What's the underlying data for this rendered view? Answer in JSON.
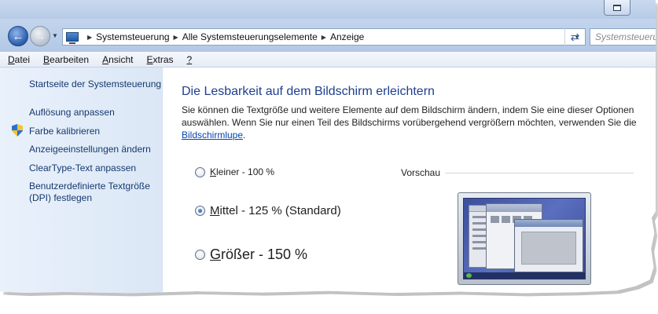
{
  "window": {
    "title_button": "restore-button"
  },
  "address_bar": {
    "breadcrumbs": [
      "Systemsteuerung",
      "Alle Systemsteuerungselemente",
      "Anzeige"
    ],
    "search_placeholder": "Systemsteuerun"
  },
  "menu": {
    "items": [
      {
        "accel": "D",
        "rest": "atei"
      },
      {
        "accel": "B",
        "rest": "earbeiten"
      },
      {
        "accel": "A",
        "rest": "nsicht"
      },
      {
        "accel": "E",
        "rest": "xtras"
      },
      {
        "accel": "?",
        "rest": ""
      }
    ]
  },
  "sidebar": {
    "home": "Startseite der Systemsteuerung",
    "links": [
      "Auflösung anpassen",
      "Farbe kalibrieren",
      "Anzeigeeinstellungen ändern",
      "ClearType-Text anpassen",
      "Benutzerdefinierte Textgröße",
      "(DPI) festlegen"
    ]
  },
  "main": {
    "heading": "Die Lesbarkeit auf dem Bildschirm erleichtern",
    "desc_line1": "Sie können die Textgröße und weitere Elemente auf dem Bildschirm ändern, indem Sie eine dieser Optionen",
    "desc_line2": "auswählen. Wenn Sie nur einen Teil des Bildschirms vorübergehend vergrößern möchten, verwenden Sie die",
    "desc_link": "Bildschirmlupe",
    "desc_end": ".",
    "options": [
      {
        "accel": "K",
        "rest": "leiner - 100 %",
        "selected": false
      },
      {
        "accel": "M",
        "rest": "ittel - 125 % (Standard)",
        "selected": true
      },
      {
        "accel": "G",
        "rest": "rößer - 150 %",
        "selected": false
      }
    ],
    "preview_label": "Vorschau"
  },
  "colors": {
    "heading": "#1e3e8e",
    "link": "#16386e",
    "sidebar_bg": "#dbe7f6"
  }
}
